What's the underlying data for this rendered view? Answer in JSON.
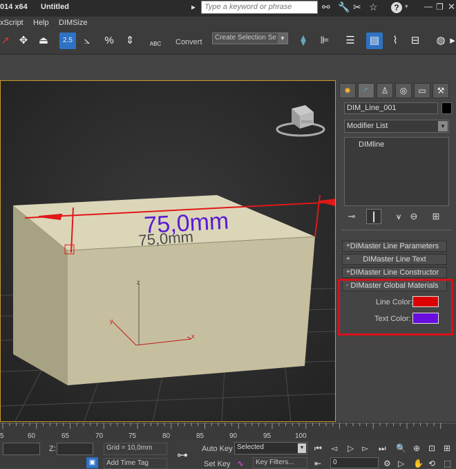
{
  "titlebar": {
    "app": "014 x64",
    "doc": "Untitled",
    "search_placeholder": "Type a keyword or phrase",
    "binoculars_icon": "binoculars-icon",
    "help_label": "?"
  },
  "menu": [
    "xScript",
    "Help",
    "DIMSize"
  ],
  "toolbar": {
    "convert_label": "Convert",
    "selection_set": "Create Selection Se",
    "tool_25": "2.5",
    "tool_pct": "%",
    "tool_abc": "ABC"
  },
  "viewport": {
    "dimension_text": "75,0mm",
    "dimension_echo": "75,0mm",
    "viewcube_label": "FRONT",
    "axis_z": "z",
    "axis_x": "x",
    "line_color": "#e01818",
    "text_color": "#5a18d6"
  },
  "panel": {
    "object_name": "DIM_Line_001",
    "modifier_list": "Modifier List",
    "stack_item": "DIMline",
    "rollouts": [
      {
        "sign": "+",
        "label": "DIMaster Line Parameters"
      },
      {
        "sign": "+",
        "label": "DIMaster Line Text"
      },
      {
        "sign": "+",
        "label": "DIMaster Line Constructor"
      },
      {
        "sign": "-",
        "label": "DIMaster Global Materials"
      }
    ],
    "line_color_label": "Line Color:",
    "text_color_label": "Text Color:",
    "line_color": "#dd0000",
    "text_color": "#6a0de0"
  },
  "timeline": {
    "ticks": [
      "5",
      "60",
      "65",
      "70",
      "75",
      "80",
      "85",
      "90",
      "95",
      "100"
    ]
  },
  "status": {
    "z_label": "Z:",
    "grid": "Grid = 10,0mm",
    "add_time_tag": "Add Time Tag",
    "auto_key": "Auto Key",
    "set_key": "Set Key",
    "selected": "Selected",
    "key_filters": "Key Filters...",
    "frame": "0"
  }
}
